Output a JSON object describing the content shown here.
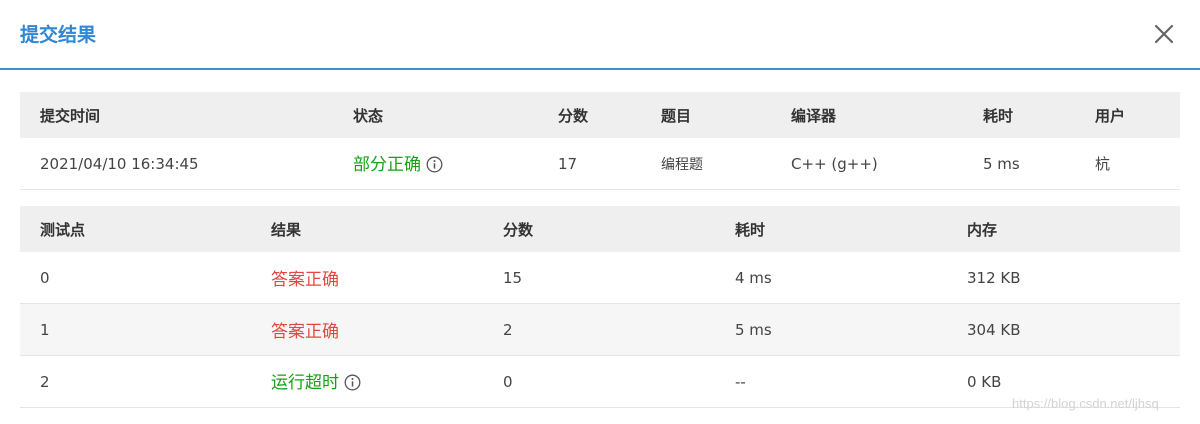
{
  "dialog": {
    "title": "提交结果",
    "close_icon": "close-icon"
  },
  "submission": {
    "headers": [
      "提交时间",
      "状态",
      "分数",
      "题目",
      "编译器",
      "耗时",
      "用户"
    ],
    "row": {
      "time": "2021/04/10 16:34:45",
      "status": "部分正确",
      "status_color": "#16a116",
      "score": "17",
      "problem": "编程题",
      "compiler": "C++ (g++)",
      "elapsed": "5 ms",
      "user": "杭"
    }
  },
  "testcases": {
    "headers": [
      "测试点",
      "结果",
      "分数",
      "耗时",
      "内存"
    ],
    "rows": [
      {
        "id": "0",
        "result": "答案正确",
        "result_color": "#e2473f",
        "score": "15",
        "time": "4 ms",
        "memory": "312 KB"
      },
      {
        "id": "1",
        "result": "答案正确",
        "result_color": "#e2473f",
        "score": "2",
        "time": "5 ms",
        "memory": "304 KB"
      },
      {
        "id": "2",
        "result": "运行超时",
        "result_color": "#16a116",
        "score": "0",
        "time": "--",
        "memory": "0 KB"
      }
    ]
  },
  "watermark": "https://blog.csdn.net/ljhsq"
}
